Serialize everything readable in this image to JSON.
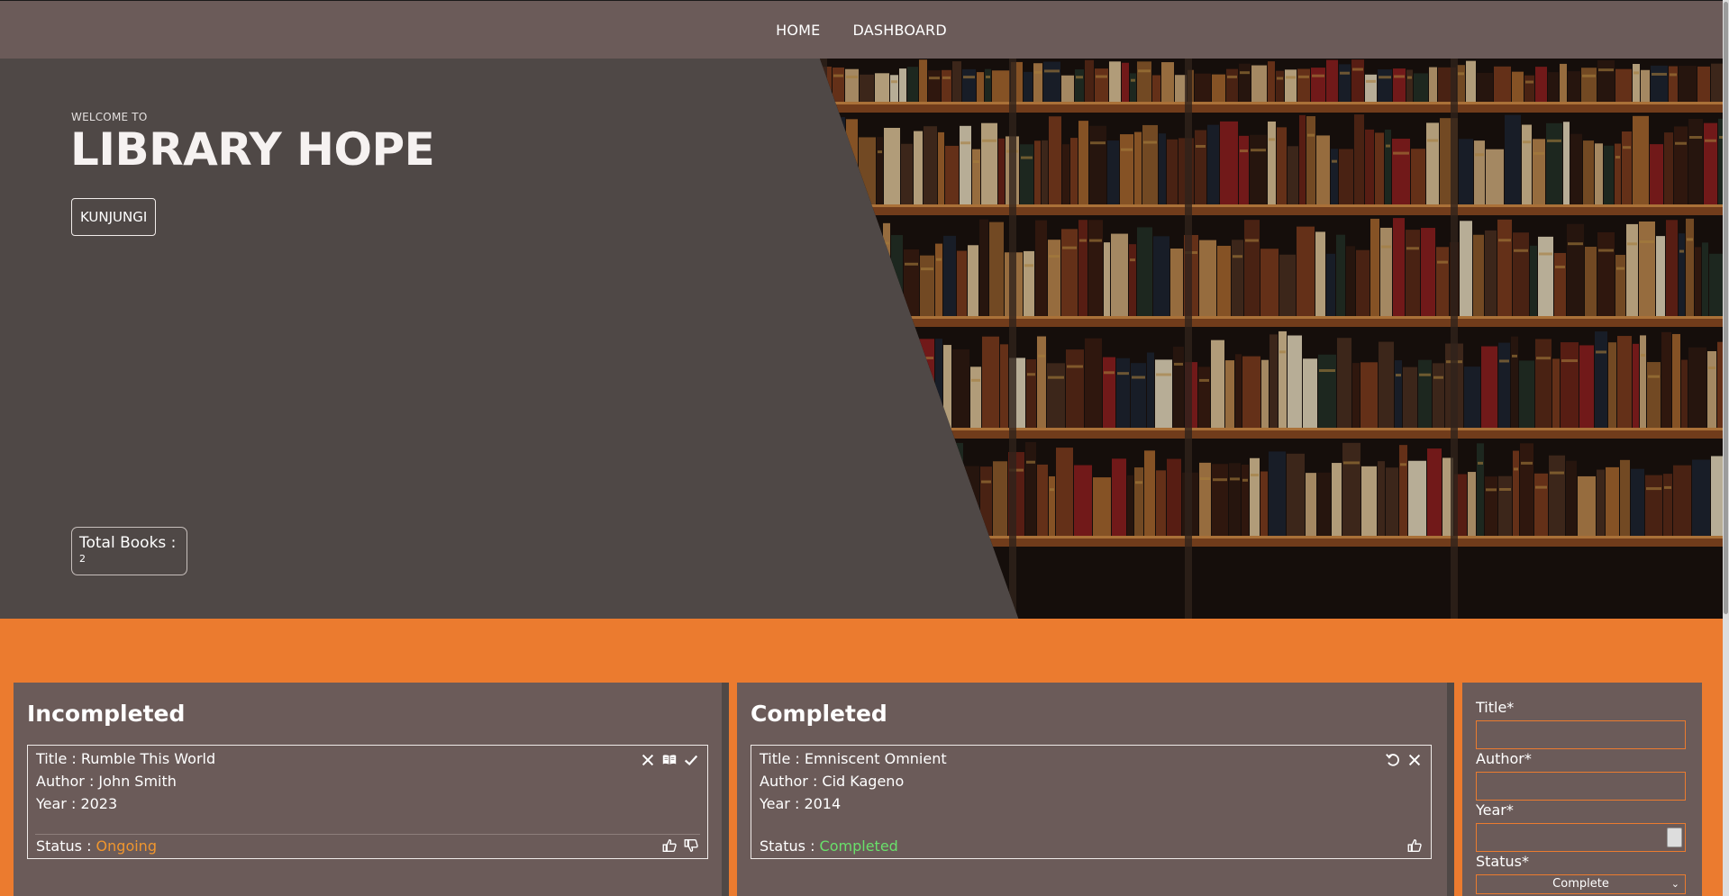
{
  "nav": {
    "home": "HOME",
    "dashboard": "DASHBOARD"
  },
  "hero": {
    "welcome": "WELCOME TO",
    "title": "LIBRARY HOPE",
    "button": "KUNJUNGI",
    "total_label": "Total Books :",
    "total_value": "2"
  },
  "incompleted": {
    "heading": "Incompleted",
    "book": {
      "title": "Title : Rumble This World",
      "author": "Author : John Smith",
      "year": "Year : 2023",
      "status_label": "Status : ",
      "status_value": "Ongoing"
    }
  },
  "completed": {
    "heading": "Completed",
    "book": {
      "title": "Title : Emniscent Omnient",
      "author": "Author : Cid Kageno",
      "year": "Year : 2014",
      "status_label": "Status : ",
      "status_value": "Completed"
    }
  },
  "form": {
    "title_label": "Title*",
    "author_label": "Author*",
    "year_label": "Year*",
    "status_label": "Status*",
    "status_selected": "Complete"
  },
  "colors": {
    "nav_bg": "#6b5b59",
    "hero_bg": "#4f4846",
    "accent": "#eb7b2f",
    "ongoing": "#f0962e",
    "completed": "#69e06b"
  },
  "icons": {
    "delete": "close-icon",
    "read": "open-book-icon",
    "complete": "check-icon",
    "undo": "undo-icon",
    "like": "thumbs-up-icon",
    "dislike": "thumbs-down-icon"
  }
}
